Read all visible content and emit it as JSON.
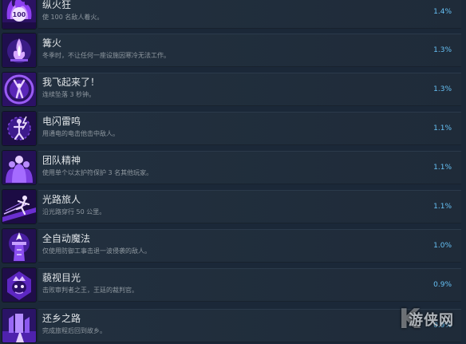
{
  "achievements": [
    {
      "title": "纵火狂",
      "desc": "使 100 名敌人着火。",
      "percent": "1.4%",
      "icon": "fire-skull-100-icon"
    },
    {
      "title": "篝火",
      "desc": "冬季时，不让任何一座设施因寒冷无法工作。",
      "percent": "1.3%",
      "icon": "bonfire-icon"
    },
    {
      "title": "我飞起来了！",
      "desc": "连续坠落 3 秒钟。",
      "percent": "1.3%",
      "icon": "falling-figure-icon"
    },
    {
      "title": "电闪雷鸣",
      "desc": "用通电的电击他击中敌人。",
      "percent": "1.1%",
      "icon": "lightning-figure-icon"
    },
    {
      "title": "团队精神",
      "desc": "使用单个以太护符保护 3 名其他玩家。",
      "percent": "1.1%",
      "icon": "team-spirit-icon"
    },
    {
      "title": "光路旅人",
      "desc": "沿光路穿行 50 公里。",
      "percent": "1.1%",
      "icon": "light-path-runner-icon"
    },
    {
      "title": "全自动魔法",
      "desc": "仅使用防御工事击退一波侵袭的敌人。",
      "percent": "1.0%",
      "icon": "auto-magic-tower-icon"
    },
    {
      "title": "藐视目光",
      "desc": "击败审判者之王，王廷的裁判官。",
      "percent": "0.9%",
      "icon": "judge-king-icon"
    },
    {
      "title": "还乡之路",
      "desc": "完成旅程后回到故乡。",
      "percent": "0.9%",
      "icon": "homeward-road-icon"
    }
  ],
  "watermark": {
    "glyph": "K",
    "text": "游侠网"
  }
}
